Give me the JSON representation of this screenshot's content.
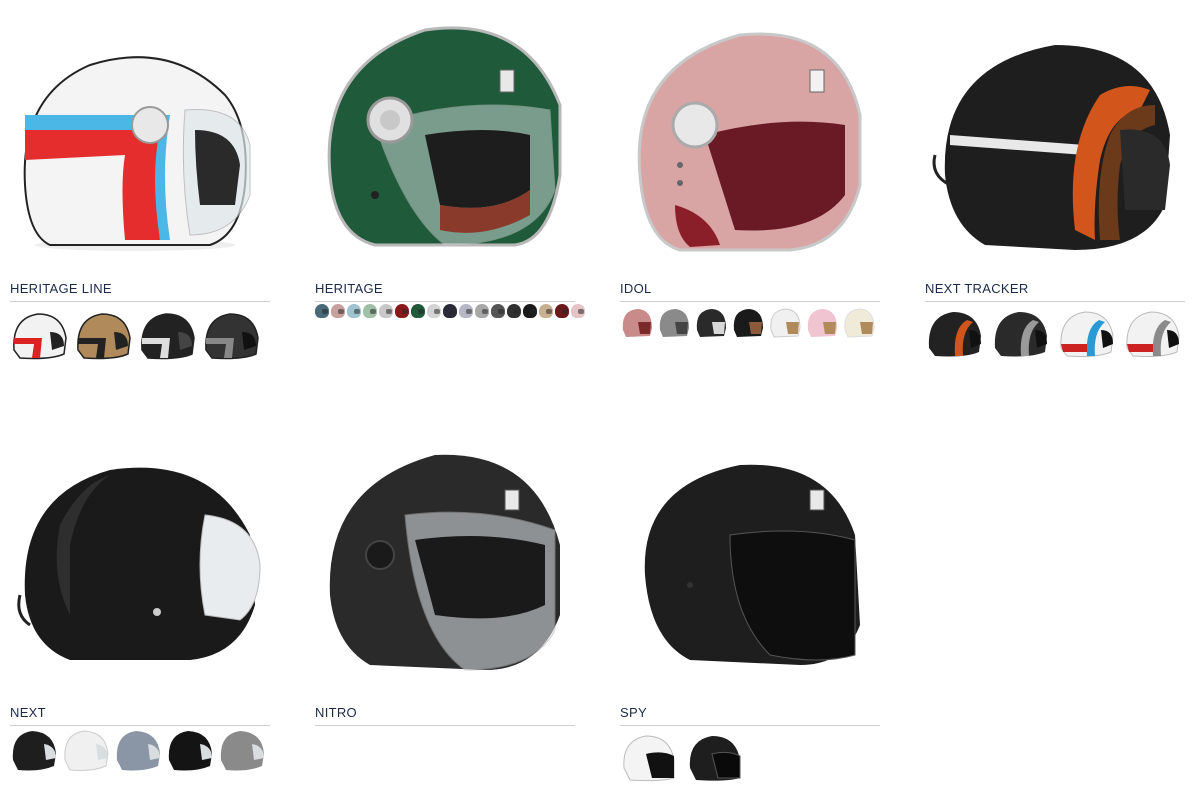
{
  "products": [
    {
      "name": "HERITAGE LINE",
      "colors": {
        "shell": "#f4f4f4",
        "stripe1": "#e52d2d",
        "stripe2": "#4bb7e6",
        "trim": "#1a1a1a"
      },
      "swatches": [
        {
          "shell": "#f2f2f2",
          "stripe": "#d22"
        },
        {
          "shell": "#b08a5a",
          "stripe": "#222"
        },
        {
          "shell": "#222222",
          "stripe": "#ddd"
        },
        {
          "shell": "#333333",
          "stripe": "#888"
        }
      ]
    },
    {
      "name": "HERITAGE",
      "colors": {
        "shell": "#1f5a3a",
        "interior": "#8a3a2a",
        "trim": "#c8c8c8"
      },
      "mini": [
        "#4a6a7a",
        "#c9a0a0",
        "#9fc3d0",
        "#a0c0a8",
        "#c8c8c8",
        "#8a1a1a",
        "#1f5a3a",
        "#d4d4d4",
        "#2a2a3a",
        "#b6b6c6",
        "#a8a8a8",
        "#555555",
        "#303030",
        "#1a1a1a",
        "#c8b090",
        "#6a1a1a",
        "#e4c4c4"
      ]
    },
    {
      "name": "IDOL",
      "colors": {
        "shell": "#d9a4a4",
        "interior": "#8a1f2a",
        "trim": "#d8d8d8"
      },
      "swatches": [
        {
          "shell": "#c98a8a",
          "stripe": "#7a2a2a"
        },
        {
          "shell": "#8a8a8a",
          "stripe": "#444"
        },
        {
          "shell": "#2a2a2a",
          "stripe": "#d8d8d8"
        },
        {
          "shell": "#1a1a1a",
          "stripe": "#8a5a3a"
        },
        {
          "shell": "#f0f0f0",
          "stripe": "#b08a5a"
        },
        {
          "shell": "#f0c4d0",
          "stripe": "#b08a5a"
        },
        {
          "shell": "#f0ead8",
          "stripe": "#b08a5a"
        }
      ]
    },
    {
      "name": "NEXT TRACKER",
      "colors": {
        "shell": "#1e1e1e",
        "stripe1": "#d2561c",
        "stripe2": "#6a3a1a",
        "trim": "#e8e8e8"
      },
      "swatches": [
        {
          "shell": "#222222",
          "stripe": "#d2561c"
        },
        {
          "shell": "#2a2a2a",
          "stripe": "#9a9a9a"
        },
        {
          "shell": "#f2f2f2",
          "stripe": "#2a9ad6"
        },
        {
          "shell": "#f2f2f2",
          "stripe": "#8a8a8a"
        }
      ]
    },
    {
      "name": "NEXT",
      "colors": {
        "shell": "#1a1a1a",
        "visor": "#e8ecef"
      },
      "swatches": [
        {
          "shell": "#1e1e1e",
          "stripe": "#1e1e1e"
        },
        {
          "shell": "#f0f0f0",
          "stripe": "#f0f0f0"
        },
        {
          "shell": "#8a96a6",
          "stripe": "#8a96a6"
        },
        {
          "shell": "#141414",
          "stripe": "#141414"
        },
        {
          "shell": "#8a8a8a",
          "stripe": "#8a8a8a"
        }
      ]
    },
    {
      "name": "NITRO",
      "colors": {
        "shell": "#2a2a2a",
        "visor": "#e0e6ea"
      }
    },
    {
      "name": "SPY",
      "colors": {
        "shell": "#1e1e1e",
        "visor": "#0e0e0e"
      },
      "swatches": [
        {
          "shell": "#f4f4f4",
          "stripe": "#111"
        },
        {
          "shell": "#1e1e1e",
          "stripe": "#111"
        }
      ]
    }
  ]
}
